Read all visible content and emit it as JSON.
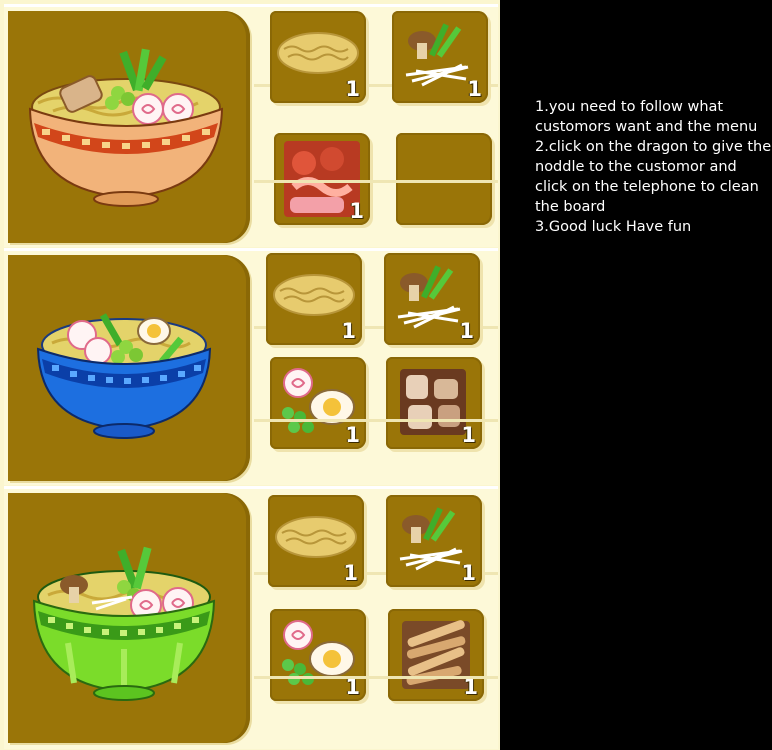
{
  "instructions": [
    "1.you need to follow what customors want and the menu",
    "2.click on the dragon to give the noddle to the customor and click on the telephone to clean the board",
    "3.Good luck Have fun"
  ],
  "recipes": [
    {
      "bowl": "orange-ramen-bowl",
      "bowl_color": "#e8753a",
      "ingredients": [
        {
          "name": "noodles",
          "count": "1"
        },
        {
          "name": "mushroom-scallion-bean-sprouts",
          "count": "1"
        },
        {
          "name": "shrimp-and-meat",
          "count": "1"
        },
        {
          "name": "empty",
          "count": ""
        }
      ]
    },
    {
      "bowl": "blue-ramen-bowl",
      "bowl_color": "#1d6fe0",
      "ingredients": [
        {
          "name": "noodles",
          "count": "1"
        },
        {
          "name": "mushroom-scallion-bean-sprouts",
          "count": "1"
        },
        {
          "name": "narutomaki-peas-egg",
          "count": "1"
        },
        {
          "name": "pork-slices",
          "count": "1"
        }
      ]
    },
    {
      "bowl": "green-ramen-bowl",
      "bowl_color": "#6fd21f",
      "ingredients": [
        {
          "name": "noodles",
          "count": "1"
        },
        {
          "name": "mushroom-scallion-bean-sprouts",
          "count": "1"
        },
        {
          "name": "narutomaki-peas-egg",
          "count": "1"
        },
        {
          "name": "bamboo-shoots",
          "count": "1"
        }
      ]
    }
  ]
}
